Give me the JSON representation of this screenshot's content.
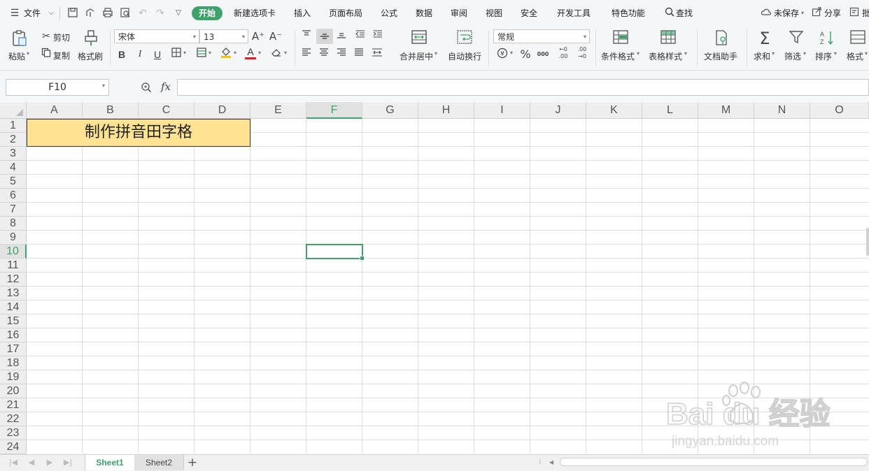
{
  "menubar": {
    "file_label": "文件",
    "tabs": [
      {
        "label": "开始",
        "active": true
      },
      {
        "label": "新建选项卡"
      },
      {
        "label": "插入"
      },
      {
        "label": "页面布局"
      },
      {
        "label": "公式"
      },
      {
        "label": "数据"
      },
      {
        "label": "审阅"
      },
      {
        "label": "视图"
      },
      {
        "label": "安全"
      },
      {
        "label": "开发工具"
      },
      {
        "label": "特色功能"
      }
    ],
    "search_label": "查找",
    "unsaved_label": "未保存",
    "share_label": "分享",
    "comment_label": "批"
  },
  "ribbon": {
    "paste_label": "粘贴",
    "cut_label": "剪切",
    "copy_label": "复制",
    "format_painter_label": "格式刷",
    "font_name": "宋体",
    "font_size": "13",
    "merge_label": "合并居中",
    "wrap_label": "自动换行",
    "number_format": "常规",
    "cond_format_label": "条件格式",
    "table_style_label": "表格样式",
    "doc_helper_label": "文档助手",
    "sum_label": "求和",
    "filter_label": "筛选",
    "sort_label": "排序",
    "format_label": "格式",
    "currency_symbol": "¥",
    "percent_symbol": "%",
    "thousands_symbol": "000",
    "inc_decimal": "←0 .00",
    "dec_decimal": ".00 →0",
    "bold": "B",
    "italic": "I",
    "underline": "U",
    "font_color_letter": "A",
    "grow_font": "A⁺",
    "shrink_font": "A⁻"
  },
  "formula_bar": {
    "name_box": "F10",
    "fx": "fx",
    "formula": ""
  },
  "grid": {
    "columns": [
      "A",
      "B",
      "C",
      "D",
      "E",
      "F",
      "G",
      "H",
      "I",
      "J",
      "K",
      "L",
      "M",
      "N",
      "O"
    ],
    "rows": [
      "1",
      "2",
      "3",
      "4",
      "5",
      "6",
      "7",
      "8",
      "9",
      "10",
      "11",
      "12",
      "13",
      "14",
      "15",
      "16",
      "17",
      "18",
      "19",
      "20",
      "21",
      "22",
      "23",
      "24"
    ],
    "selected_column": "F",
    "selected_row": "10",
    "merged_title": "制作拼音田字格"
  },
  "sheets": {
    "tabs": [
      "Sheet1",
      "Sheet2"
    ],
    "active": "Sheet1",
    "add": "+"
  },
  "watermark": {
    "text": "Bai du 经验",
    "sub": "jingyan.baidu.com"
  },
  "colors": {
    "accent": "#3da36b",
    "merged_fill": "#ffe393",
    "font_color_bar": "#e02020",
    "fill_color_bar": "#f5c400"
  }
}
